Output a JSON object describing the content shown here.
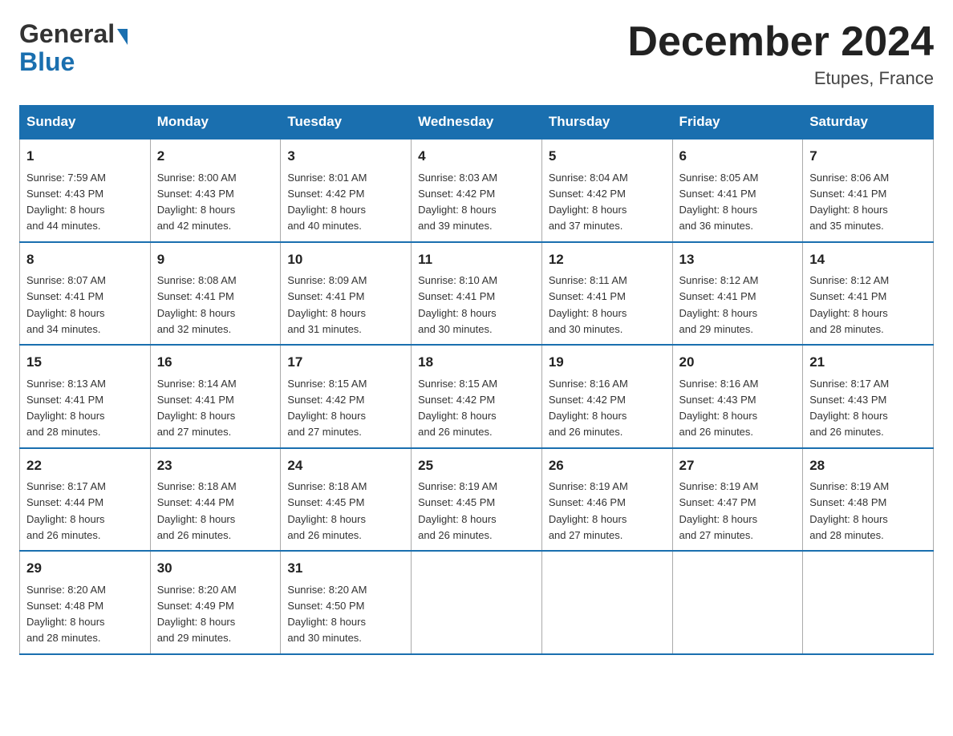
{
  "header": {
    "logo_line1": "General",
    "logo_arrow": "▶",
    "logo_line2": "Blue",
    "month_title": "December 2024",
    "location": "Etupes, France"
  },
  "days_of_week": [
    "Sunday",
    "Monday",
    "Tuesday",
    "Wednesday",
    "Thursday",
    "Friday",
    "Saturday"
  ],
  "weeks": [
    [
      {
        "day": "1",
        "sunrise": "7:59 AM",
        "sunset": "4:43 PM",
        "daylight": "8 hours and 44 minutes."
      },
      {
        "day": "2",
        "sunrise": "8:00 AM",
        "sunset": "4:43 PM",
        "daylight": "8 hours and 42 minutes."
      },
      {
        "day": "3",
        "sunrise": "8:01 AM",
        "sunset": "4:42 PM",
        "daylight": "8 hours and 40 minutes."
      },
      {
        "day": "4",
        "sunrise": "8:03 AM",
        "sunset": "4:42 PM",
        "daylight": "8 hours and 39 minutes."
      },
      {
        "day": "5",
        "sunrise": "8:04 AM",
        "sunset": "4:42 PM",
        "daylight": "8 hours and 37 minutes."
      },
      {
        "day": "6",
        "sunrise": "8:05 AM",
        "sunset": "4:41 PM",
        "daylight": "8 hours and 36 minutes."
      },
      {
        "day": "7",
        "sunrise": "8:06 AM",
        "sunset": "4:41 PM",
        "daylight": "8 hours and 35 minutes."
      }
    ],
    [
      {
        "day": "8",
        "sunrise": "8:07 AM",
        "sunset": "4:41 PM",
        "daylight": "8 hours and 34 minutes."
      },
      {
        "day": "9",
        "sunrise": "8:08 AM",
        "sunset": "4:41 PM",
        "daylight": "8 hours and 32 minutes."
      },
      {
        "day": "10",
        "sunrise": "8:09 AM",
        "sunset": "4:41 PM",
        "daylight": "8 hours and 31 minutes."
      },
      {
        "day": "11",
        "sunrise": "8:10 AM",
        "sunset": "4:41 PM",
        "daylight": "8 hours and 30 minutes."
      },
      {
        "day": "12",
        "sunrise": "8:11 AM",
        "sunset": "4:41 PM",
        "daylight": "8 hours and 30 minutes."
      },
      {
        "day": "13",
        "sunrise": "8:12 AM",
        "sunset": "4:41 PM",
        "daylight": "8 hours and 29 minutes."
      },
      {
        "day": "14",
        "sunrise": "8:12 AM",
        "sunset": "4:41 PM",
        "daylight": "8 hours and 28 minutes."
      }
    ],
    [
      {
        "day": "15",
        "sunrise": "8:13 AM",
        "sunset": "4:41 PM",
        "daylight": "8 hours and 28 minutes."
      },
      {
        "day": "16",
        "sunrise": "8:14 AM",
        "sunset": "4:41 PM",
        "daylight": "8 hours and 27 minutes."
      },
      {
        "day": "17",
        "sunrise": "8:15 AM",
        "sunset": "4:42 PM",
        "daylight": "8 hours and 27 minutes."
      },
      {
        "day": "18",
        "sunrise": "8:15 AM",
        "sunset": "4:42 PM",
        "daylight": "8 hours and 26 minutes."
      },
      {
        "day": "19",
        "sunrise": "8:16 AM",
        "sunset": "4:42 PM",
        "daylight": "8 hours and 26 minutes."
      },
      {
        "day": "20",
        "sunrise": "8:16 AM",
        "sunset": "4:43 PM",
        "daylight": "8 hours and 26 minutes."
      },
      {
        "day": "21",
        "sunrise": "8:17 AM",
        "sunset": "4:43 PM",
        "daylight": "8 hours and 26 minutes."
      }
    ],
    [
      {
        "day": "22",
        "sunrise": "8:17 AM",
        "sunset": "4:44 PM",
        "daylight": "8 hours and 26 minutes."
      },
      {
        "day": "23",
        "sunrise": "8:18 AM",
        "sunset": "4:44 PM",
        "daylight": "8 hours and 26 minutes."
      },
      {
        "day": "24",
        "sunrise": "8:18 AM",
        "sunset": "4:45 PM",
        "daylight": "8 hours and 26 minutes."
      },
      {
        "day": "25",
        "sunrise": "8:19 AM",
        "sunset": "4:45 PM",
        "daylight": "8 hours and 26 minutes."
      },
      {
        "day": "26",
        "sunrise": "8:19 AM",
        "sunset": "4:46 PM",
        "daylight": "8 hours and 27 minutes."
      },
      {
        "day": "27",
        "sunrise": "8:19 AM",
        "sunset": "4:47 PM",
        "daylight": "8 hours and 27 minutes."
      },
      {
        "day": "28",
        "sunrise": "8:19 AM",
        "sunset": "4:48 PM",
        "daylight": "8 hours and 28 minutes."
      }
    ],
    [
      {
        "day": "29",
        "sunrise": "8:20 AM",
        "sunset": "4:48 PM",
        "daylight": "8 hours and 28 minutes."
      },
      {
        "day": "30",
        "sunrise": "8:20 AM",
        "sunset": "4:49 PM",
        "daylight": "8 hours and 29 minutes."
      },
      {
        "day": "31",
        "sunrise": "8:20 AM",
        "sunset": "4:50 PM",
        "daylight": "8 hours and 30 minutes."
      },
      null,
      null,
      null,
      null
    ]
  ],
  "labels": {
    "sunrise": "Sunrise: ",
    "sunset": "Sunset: ",
    "daylight": "Daylight: "
  }
}
